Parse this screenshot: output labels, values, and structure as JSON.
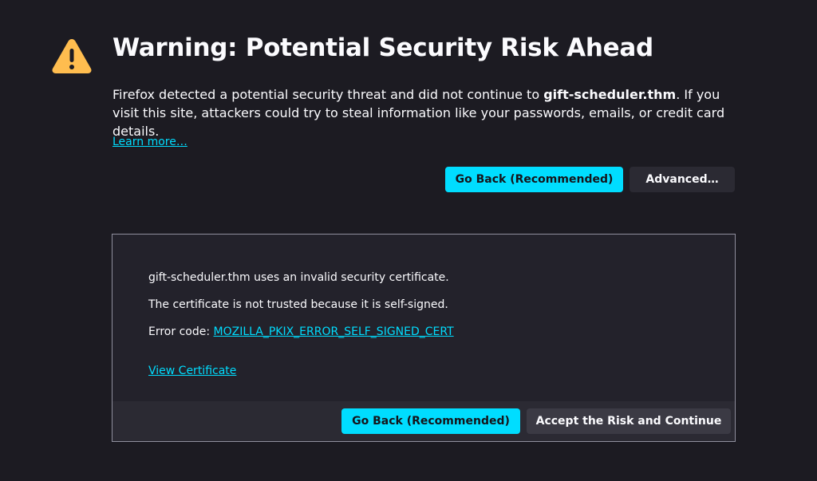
{
  "page": {
    "title": "Warning: Potential Security Risk Ahead",
    "intro_prefix": "Firefox detected a potential security threat and did not continue to ",
    "site": "gift-scheduler.thm",
    "intro_suffix": ". If you visit this site, attackers could try to steal information like your passwords, emails, or credit card details.",
    "learn_more": "Learn more…",
    "go_back_label": "Go Back (Recommended)",
    "advanced_label": "Advanced…"
  },
  "advanced_panel": {
    "line1": "gift-scheduler.thm uses an invalid security certificate.",
    "line2": "The certificate is not trusted because it is self-signed.",
    "error_prefix": "Error code: ",
    "error_code": "MOZILLA_PKIX_ERROR_SELF_SIGNED_CERT",
    "view_certificate": "View Certificate",
    "go_back_label": "Go Back (Recommended)",
    "accept_label": "Accept the Risk and Continue"
  },
  "icons": {
    "warning": "warning-triangle-icon"
  },
  "colors": {
    "background": "#1c1b22",
    "accent": "#00ddff",
    "warning": "#ffbd4f"
  }
}
